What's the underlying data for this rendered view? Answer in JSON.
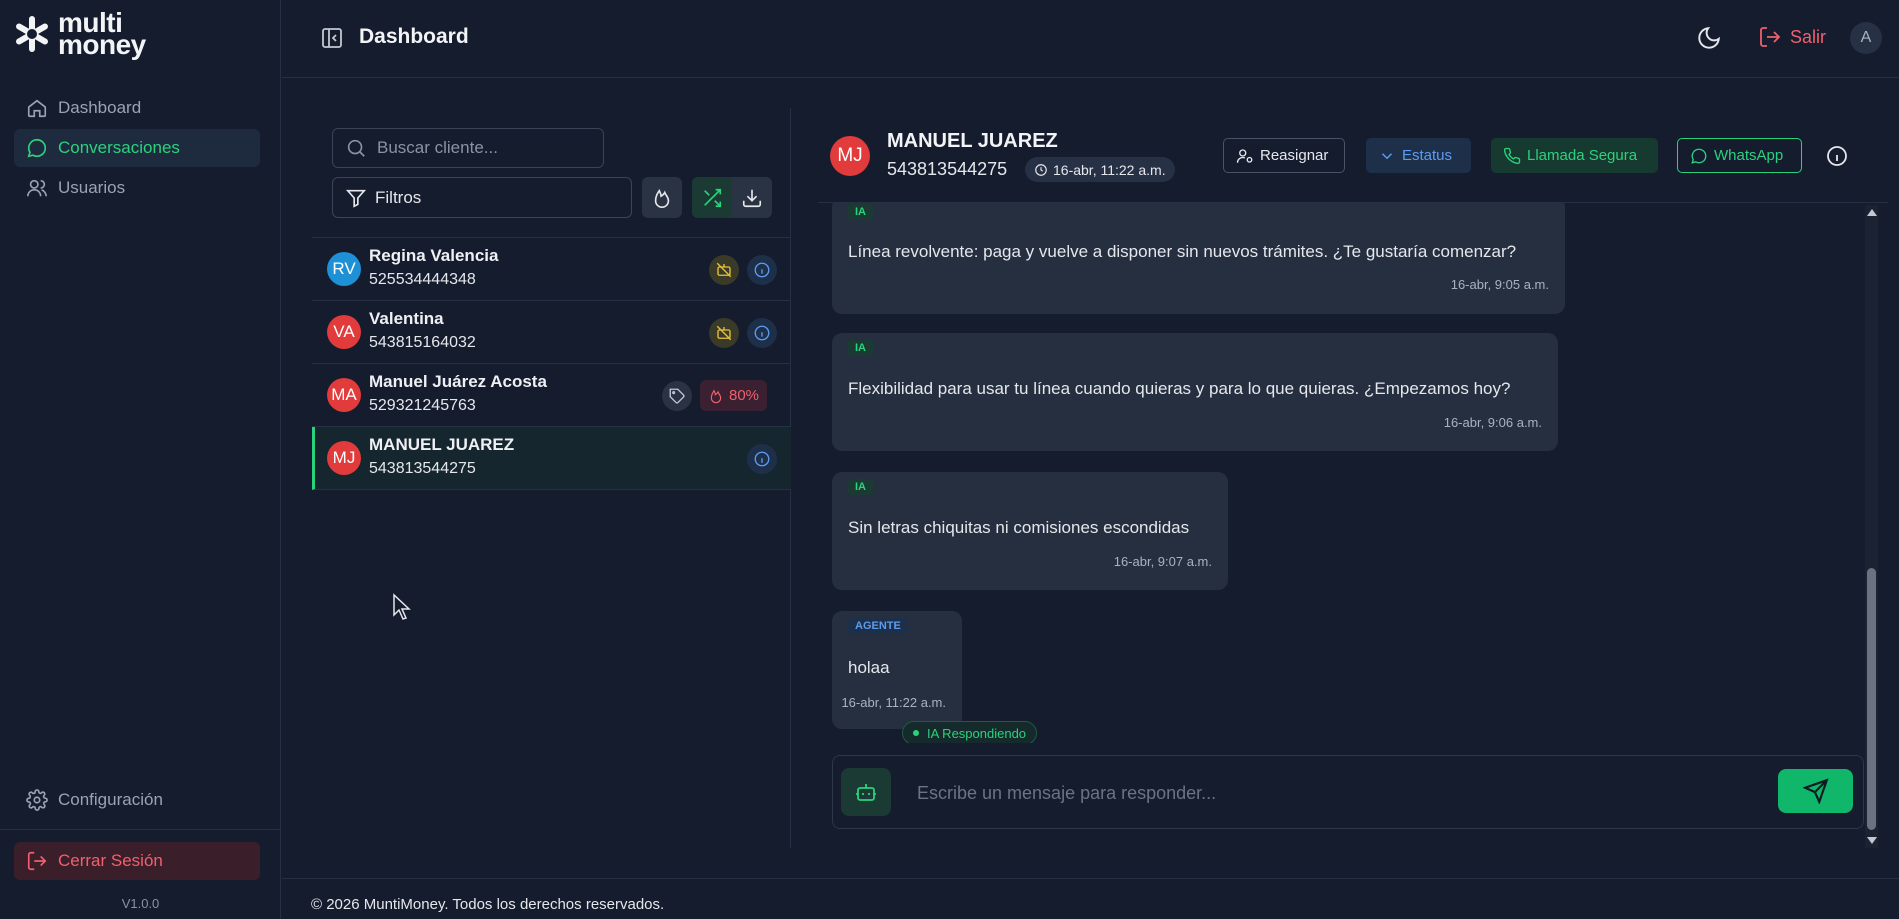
{
  "brand": {
    "line1": "multi",
    "line2": "money"
  },
  "sidebar": {
    "items": [
      {
        "label": "Dashboard",
        "icon": "home-icon"
      },
      {
        "label": "Conversaciones",
        "icon": "chat-icon"
      },
      {
        "label": "Usuarios",
        "icon": "users-icon"
      }
    ],
    "config_label": "Configuración",
    "logout_label": "Cerrar Sesión",
    "version": "V1.0.0"
  },
  "header": {
    "title": "Dashboard",
    "salir_label": "Salir",
    "avatar_initial": "A"
  },
  "list": {
    "search_placeholder": "Buscar cliente...",
    "filter_label": "Filtros",
    "conversations": [
      {
        "initials": "RV",
        "name": "Regina Valencia",
        "phone": "525534444348",
        "avatar_color": "#1e90d6"
      },
      {
        "initials": "VA",
        "name": "Valentina",
        "phone": "543815164032",
        "avatar_color": "#e23b3b"
      },
      {
        "initials": "MA",
        "name": "Manuel Juárez Acosta",
        "phone": "529321245763",
        "avatar_color": "#e23b3b",
        "heat": "80%"
      },
      {
        "initials": "MJ",
        "name": "MANUEL JUAREZ",
        "phone": "543813544275",
        "avatar_color": "#e23b3b"
      }
    ]
  },
  "chat": {
    "initials": "MJ",
    "name": "MANUEL JUAREZ",
    "phone": "543813544275",
    "time": "16-abr, 11:22 a.m.",
    "buttons": {
      "reasignar": "Reasignar",
      "estatus": "Estatus",
      "llamada": "Llamada Segura",
      "whatsapp": "WhatsApp"
    },
    "messages": [
      {
        "tag": "IA",
        "text": "Línea revolvente: paga y vuelve a disponer sin nuevos trámites. ¿Te gustaría comenzar?",
        "time": "16-abr, 9:05 a.m."
      },
      {
        "tag": "IA",
        "text": "Flexibilidad para usar tu línea cuando quieras y para lo que quieras. ¿Empezamos hoy?",
        "time": "16-abr, 9:06 a.m."
      },
      {
        "tag": "IA",
        "text": "Sin letras chiquitas ni comisiones escondidas",
        "time": "16-abr, 9:07 a.m."
      },
      {
        "tag": "AGENTE",
        "text": "holaa",
        "time": "16-abr, 11:22 a.m."
      }
    ],
    "ia_status": "IA Respondiendo",
    "composer_placeholder": "Escribe un mensaje para responder..."
  },
  "footer": {
    "text": "© 2026 MuntiMoney. Todos los derechos reservados."
  },
  "colors": {
    "accent": "#2bd27d",
    "danger": "#f0606e",
    "info": "#5b9cf0",
    "background": "#141c2e"
  }
}
